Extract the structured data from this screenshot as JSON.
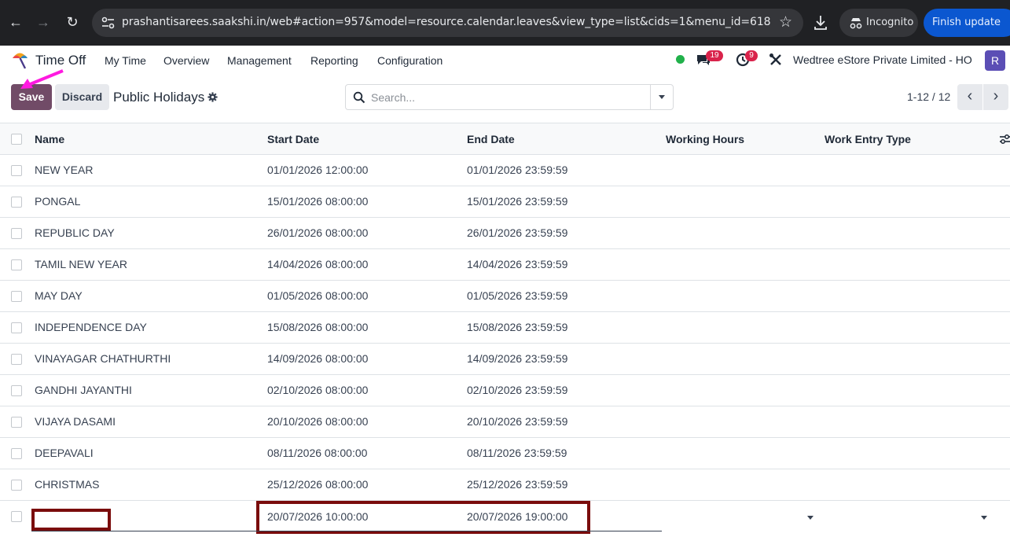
{
  "browser": {
    "url": "prashantisarees.saakshi.in/web#action=957&model=resource.calendar.leaves&view_type=list&cids=1&menu_id=618",
    "incognito_label": "Incognito",
    "update_label": "Finish update"
  },
  "nav": {
    "app_name": "Time Off",
    "menus": [
      "My Time",
      "Overview",
      "Management",
      "Reporting",
      "Configuration"
    ],
    "messages_count": "19",
    "activities_count": "9",
    "company": "Wedtree eStore Private Limited - HO",
    "avatar_initial": "R",
    "status_color": "#21b14b"
  },
  "control": {
    "save_label": "Save",
    "discard_label": "Discard",
    "title": "Public Holidays",
    "search_placeholder": "Search...",
    "pager": "1-12 / 12"
  },
  "table": {
    "columns": [
      "Name",
      "Start Date",
      "End Date",
      "Working Hours",
      "Work Entry Type"
    ],
    "rows": [
      {
        "name": "NEW YEAR",
        "start": "01/01/2026 12:00:00",
        "end": "01/01/2026 23:59:59"
      },
      {
        "name": "PONGAL",
        "start": "15/01/2026 08:00:00",
        "end": "15/01/2026 23:59:59"
      },
      {
        "name": "REPUBLIC DAY",
        "start": "26/01/2026 08:00:00",
        "end": "26/01/2026 23:59:59"
      },
      {
        "name": "TAMIL NEW YEAR",
        "start": "14/04/2026 08:00:00",
        "end": "14/04/2026 23:59:59"
      },
      {
        "name": "MAY DAY",
        "start": "01/05/2026 08:00:00",
        "end": "01/05/2026 23:59:59"
      },
      {
        "name": "INDEPENDENCE DAY",
        "start": "15/08/2026 08:00:00",
        "end": "15/08/2026 23:59:59"
      },
      {
        "name": "VINAYAGAR CHATHURTHI",
        "start": "14/09/2026 08:00:00",
        "end": "14/09/2026 23:59:59"
      },
      {
        "name": "GANDHI JAYANTHI",
        "start": "02/10/2026 08:00:00",
        "end": "02/10/2026 23:59:59"
      },
      {
        "name": "VIJAYA DASAMI",
        "start": "20/10/2026 08:00:00",
        "end": "20/10/2026 23:59:59"
      },
      {
        "name": "DEEPAVALI",
        "start": "08/11/2026 08:00:00",
        "end": "08/11/2026 23:59:59"
      },
      {
        "name": "CHRISTMAS",
        "start": "25/12/2026 08:00:00",
        "end": "25/12/2026 23:59:59"
      }
    ],
    "new_row": {
      "name": "",
      "start": "20/07/2026 10:00:00",
      "end": "20/07/2026 19:00:00"
    }
  },
  "colors": {
    "primary": "#714b67",
    "annotation_box": "#7a0c0c",
    "annotation_arrow": "#ff19e0"
  }
}
